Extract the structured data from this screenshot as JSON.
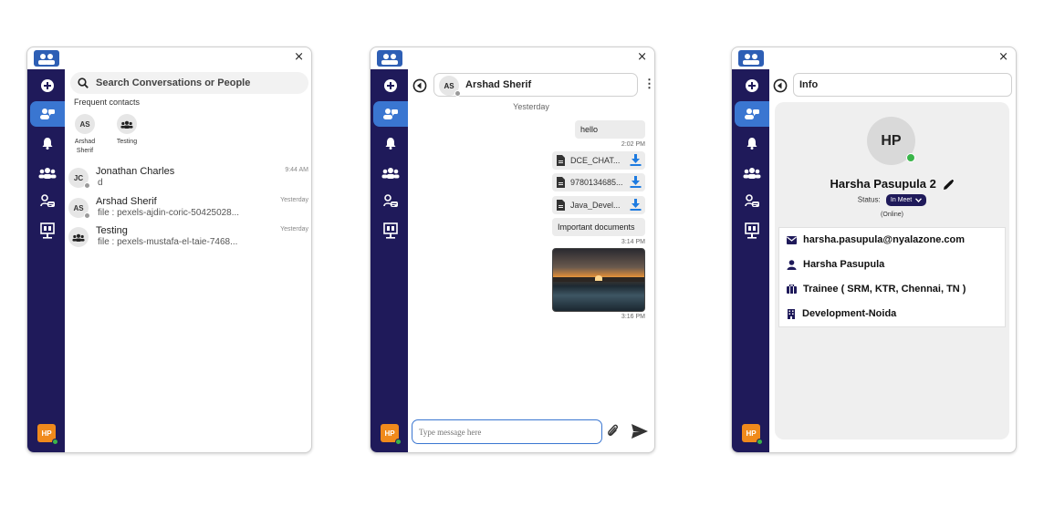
{
  "window": {
    "close_glyph": "×"
  },
  "sidebar": {
    "items": [
      {
        "icon": "plus-circle-icon"
      },
      {
        "icon": "chat-users-icon"
      },
      {
        "icon": "bell-icon"
      },
      {
        "icon": "group-icon"
      },
      {
        "icon": "support-chat-icon"
      },
      {
        "icon": "presentation-board-icon"
      }
    ],
    "user_avatar": "HP"
  },
  "conversations_panel": {
    "search_placeholder": "Search Conversations or People",
    "frequent_label": "Frequent contacts",
    "frequent_contacts": [
      {
        "initials": "AS",
        "name": "Arshad Sherif"
      },
      {
        "initials": "",
        "name": "Testing"
      }
    ],
    "conversations": [
      {
        "initials": "JC",
        "name": "Jonathan Charles",
        "last_message": "d",
        "time": "9:44 AM"
      },
      {
        "initials": "AS",
        "name": "Arshad Sherif",
        "last_message": "file : pexels-ajdin-coric-50425028...",
        "time": "Yesterday"
      },
      {
        "initials": "",
        "name": "Testing",
        "last_message": "file : pexels-mustafa-el-taie-7468...",
        "time": "Yesterday"
      }
    ]
  },
  "chat_panel": {
    "contact_initials": "AS",
    "contact_name": "Arshad Sherif",
    "day_separator": "Yesterday",
    "messages": [
      {
        "text": "hello",
        "time": "2:02 PM"
      },
      {
        "file": "DCE_CHAT..."
      },
      {
        "file": "9780134685..."
      },
      {
        "file": "Java_Devel..."
      },
      {
        "text": "Important documents",
        "time": "3:14 PM"
      },
      {
        "image": "sunset-photo",
        "time": "3:16 PM"
      }
    ],
    "input_placeholder": "Type message here"
  },
  "info_panel": {
    "title": "Info",
    "avatar_initials": "HP",
    "name": "Harsha Pasupula 2",
    "status_label": "Status:",
    "status_value": "In Meet",
    "presence": "(Online)",
    "details": [
      {
        "icon": "envelope-icon",
        "value": "harsha.pasupula@nyalazone.com"
      },
      {
        "icon": "person-icon",
        "value": "Harsha Pasupula"
      },
      {
        "icon": "briefcase-icon",
        "value": "Trainee ( SRM, KTR, Chennai, TN )"
      },
      {
        "icon": "building-icon",
        "value": "Development-Noida"
      }
    ]
  },
  "colors": {
    "rail": "#1f1a5a",
    "active": "#3a76d1",
    "avatar_orange": "#f08a1c",
    "online_green": "#3ab54a",
    "download_blue": "#1e7be0"
  }
}
